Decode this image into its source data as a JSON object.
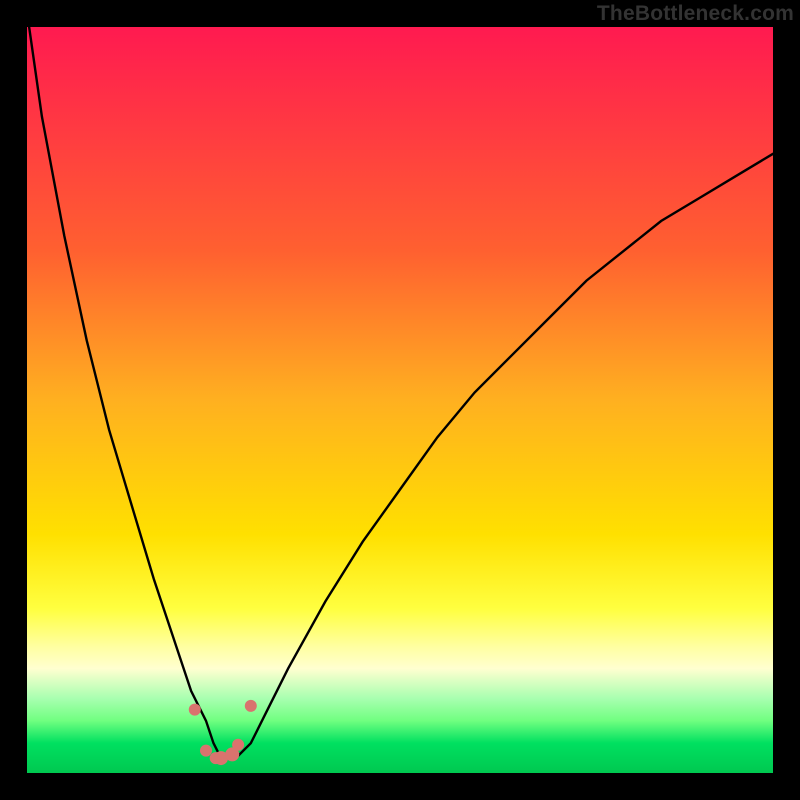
{
  "watermark_text": "TheBottleneck.com",
  "chart_data": {
    "type": "line",
    "title": "",
    "xlabel": "",
    "ylabel": "",
    "x_range": [
      0,
      100
    ],
    "y_range": [
      0,
      100
    ],
    "series": [
      {
        "name": "bottleneck-curve",
        "x": [
          0,
          2,
          5,
          8,
          11,
          14,
          17,
          20,
          22,
          24,
          25,
          26,
          27,
          28,
          30,
          32,
          35,
          40,
          45,
          50,
          55,
          60,
          65,
          70,
          75,
          80,
          85,
          90,
          95,
          100
        ],
        "y": [
          102,
          88,
          72,
          58,
          46,
          36,
          26,
          17,
          11,
          7,
          4,
          2,
          2,
          2,
          4,
          8,
          14,
          23,
          31,
          38,
          45,
          51,
          56,
          61,
          66,
          70,
          74,
          77,
          80,
          83
        ]
      }
    ],
    "markers": {
      "name": "highlight-points",
      "x": [
        22.5,
        24.0,
        25.3,
        26.0,
        27.5,
        28.3,
        30.0
      ],
      "y": [
        8.5,
        3.0,
        2.0,
        2.0,
        2.5,
        3.8,
        9.0
      ],
      "r": [
        6,
        6,
        6,
        7,
        7,
        6,
        6
      ]
    },
    "gradient_stops": [
      {
        "pos": 0,
        "color": "#ff1a50"
      },
      {
        "pos": 30,
        "color": "#ff6030"
      },
      {
        "pos": 50,
        "color": "#ffb020"
      },
      {
        "pos": 68,
        "color": "#ffe000"
      },
      {
        "pos": 78,
        "color": "#ffff40"
      },
      {
        "pos": 86,
        "color": "#ffffd0"
      },
      {
        "pos": 92,
        "color": "#70ff80"
      },
      {
        "pos": 100,
        "color": "#00c850"
      }
    ],
    "annotations": [],
    "legend": null
  }
}
